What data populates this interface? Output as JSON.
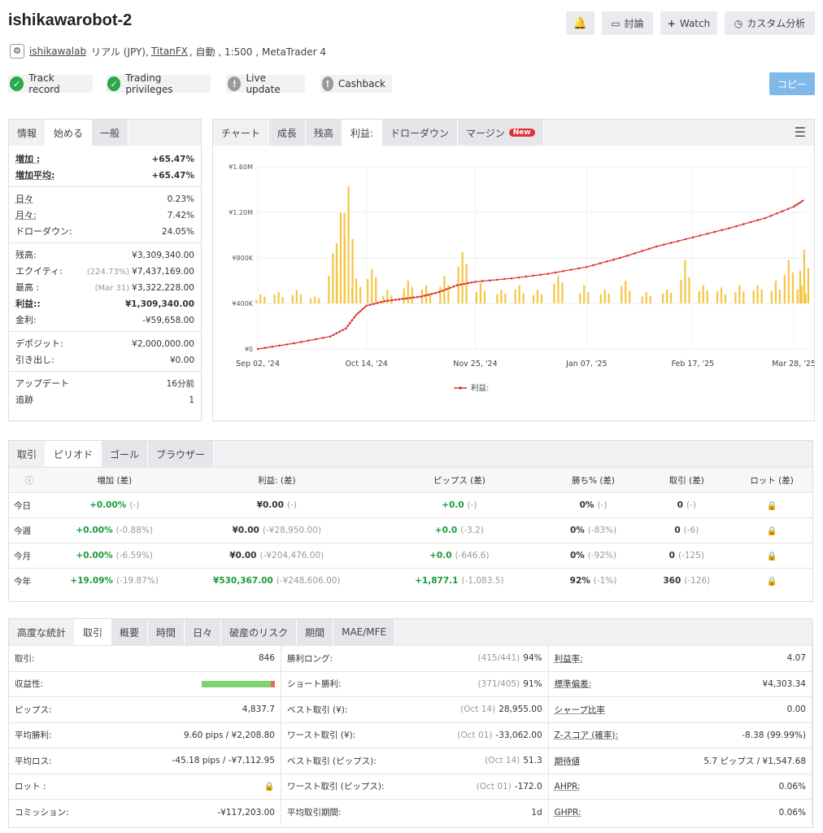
{
  "header": {
    "title": "ishikawarobot-2",
    "discuss": "討論",
    "watch": "Watch",
    "custom": "カスタム分析",
    "user": "ishikawalab",
    "account_type": "リアル (JPY),",
    "broker": "TitanFX",
    "details": ", 自動 , 1:500 , MetaTrader 4"
  },
  "badges": [
    {
      "label": "Track record",
      "ok": true
    },
    {
      "label": "Trading privileges",
      "ok": true
    },
    {
      "label": "Live update",
      "ok": false
    },
    {
      "label": "Cashback",
      "ok": false
    }
  ],
  "copy_button": "コピー",
  "info": {
    "tabs": [
      "情報",
      "始める",
      "一般"
    ],
    "rows": [
      {
        "k": "増加 :",
        "v": "+65.47%",
        "g": true,
        "ul": true
      },
      {
        "k": "増加平均:",
        "v": "+65.47%",
        "g": true,
        "ul": true
      },
      {
        "sep": true
      },
      {
        "k": "日々",
        "v": "0.23%",
        "ul": true
      },
      {
        "k": "月々:",
        "v": "7.42%",
        "ul": true
      },
      {
        "k": "ドローダウン:",
        "v": "24.05%"
      },
      {
        "sep": true
      },
      {
        "k": "残高:",
        "v": "¥3,309,340.00"
      },
      {
        "k": "エクイティ:",
        "pre": "(224.73%)",
        "v": "¥7,437,169.00"
      },
      {
        "k": "最高 :",
        "pre": "(Mar 31)",
        "v": "¥3,322,228.00"
      },
      {
        "k": "利益::",
        "v": "¥1,309,340.00",
        "g": true
      },
      {
        "k": "金利:",
        "v": "-¥59,658.00"
      },
      {
        "sep": true
      },
      {
        "k": "デポジット:",
        "v": "¥2,000,000.00"
      },
      {
        "k": "引き出し:",
        "v": "¥0.00"
      },
      {
        "sep": true
      },
      {
        "k": "アップデート",
        "v": "16分前"
      },
      {
        "k": "追跡",
        "v": "1"
      }
    ]
  },
  "chart_tabs": [
    {
      "label": "チャート"
    },
    {
      "label": "成長"
    },
    {
      "label": "残高"
    },
    {
      "label": "利益:"
    },
    {
      "label": "ドローダウン"
    },
    {
      "label": "マージン"
    }
  ],
  "new_badge": "New",
  "chart_data": {
    "type": "line",
    "x_ticks": [
      "Sep 02, '24",
      "Oct 14, '24",
      "Nov 25, '24",
      "Jan 07, '25",
      "Feb 17, '25",
      "Mar 28, '25"
    ],
    "y_ticks": [
      "¥0",
      "¥400K",
      "¥800K",
      "¥1.20M",
      "¥1.60M"
    ],
    "ylim": [
      0,
      1600000
    ],
    "series": [
      {
        "name": "利益:",
        "color": "#e03030",
        "x": [
          "2024-09-02",
          "2024-09-16",
          "2024-09-30",
          "2024-10-06",
          "2024-10-10",
          "2024-10-14",
          "2024-10-21",
          "2024-10-28",
          "2024-11-04",
          "2024-11-11",
          "2024-11-18",
          "2024-11-25",
          "2024-12-09",
          "2024-12-23",
          "2025-01-07",
          "2025-01-20",
          "2025-02-03",
          "2025-02-17",
          "2025-03-03",
          "2025-03-17",
          "2025-03-28",
          "2025-04-01"
        ],
        "values": [
          0,
          50000,
          110000,
          180000,
          300000,
          380000,
          420000,
          440000,
          460000,
          500000,
          560000,
          590000,
          620000,
          660000,
          720000,
          800000,
          900000,
          980000,
          1060000,
          1150000,
          1250000,
          1309340
        ]
      }
    ],
    "bars": {
      "color": "#f5c542",
      "baseline": 400000,
      "x": [
        "2024-09-03",
        "2024-09-10",
        "2024-09-17",
        "2024-09-24",
        "2024-10-01",
        "2024-10-04",
        "2024-10-07",
        "2024-10-10",
        "2024-10-16",
        "2024-10-22",
        "2024-10-30",
        "2024-11-06",
        "2024-11-13",
        "2024-11-20",
        "2024-11-27",
        "2024-12-05",
        "2024-12-12",
        "2024-12-19",
        "2024-12-27",
        "2025-01-06",
        "2025-01-14",
        "2025-01-22",
        "2025-01-30",
        "2025-02-07",
        "2025-02-14",
        "2025-02-21",
        "2025-02-28",
        "2025-03-07",
        "2025-03-14",
        "2025-03-21",
        "2025-03-26",
        "2025-03-31",
        "2025-04-01"
      ],
      "values": [
        480000,
        500000,
        520000,
        460000,
        840000,
        1200000,
        1430000,
        620000,
        700000,
        520000,
        600000,
        560000,
        640000,
        850000,
        580000,
        520000,
        560000,
        520000,
        640000,
        560000,
        520000,
        600000,
        500000,
        520000,
        780000,
        560000,
        540000,
        560000,
        560000,
        600000,
        780000,
        560000,
        870000
      ]
    },
    "legend": "利益:",
    "legend_position": "bottom"
  },
  "period": {
    "tabs": [
      "取引",
      "ピリオド",
      "ゴール",
      "ブラウザー"
    ],
    "headers": [
      "増加 (差)",
      "利益: (差)",
      "ピップス (差)",
      "勝ち% (差)",
      "取引 (差)",
      "ロット (差)"
    ],
    "rows": [
      {
        "label": "今日",
        "gain": "+0.00%",
        "gain_d": "(-)",
        "profit": "¥0.00",
        "profit_d": "(-)",
        "pips": "+0.0",
        "pips_d": "(-)",
        "win": "0%",
        "win_d": "(-)",
        "trades": "0",
        "trades_d": "(-)"
      },
      {
        "label": "今週",
        "gain": "+0.00%",
        "gain_d": "(-0.88%)",
        "profit": "¥0.00",
        "profit_d": "(-¥28,950.00)",
        "pips": "+0.0",
        "pips_d": "(-3.2)",
        "win": "0%",
        "win_d": "(-83%)",
        "trades": "0",
        "trades_d": "(-6)"
      },
      {
        "label": "今月",
        "gain": "+0.00%",
        "gain_d": "(-6.59%)",
        "profit": "¥0.00",
        "profit_d": "(-¥204,476.00)",
        "pips": "+0.0",
        "pips_d": "(-646.6)",
        "win": "0%",
        "win_d": "(-92%)",
        "trades": "0",
        "trades_d": "(-125)"
      },
      {
        "label": "今年",
        "gain": "+19.09%",
        "gain_d": "(-19.87%)",
        "profit": "¥530,367.00",
        "profit_d": "(-¥248,606.00)",
        "pips": "+1,877.1",
        "pips_d": "(-1,083.5)",
        "win": "92%",
        "win_d": "(-1%)",
        "trades": "360",
        "trades_d": "(-126)",
        "green_profit": true
      }
    ]
  },
  "stats": {
    "tabs": [
      "高度な統計",
      "取引",
      "概要",
      "時間",
      "日々",
      "破産のリスク",
      "期間",
      "MAE/MFE"
    ],
    "profitability_win_fraction": 0.94,
    "rows": [
      [
        {
          "k": "取引:",
          "v": "846"
        },
        {
          "k": "勝利ロング:",
          "pre": "(415/441)",
          "v": "94%"
        },
        {
          "k": "利益率:",
          "v": "4.07",
          "ul": true
        }
      ],
      [
        {
          "k": "収益性:",
          "bar": true
        },
        {
          "k": "ショート勝利:",
          "pre": "(371/405)",
          "v": "91%"
        },
        {
          "k": "標準偏差:",
          "v": "¥4,303.34",
          "ul": true
        }
      ],
      [
        {
          "k": "ピップス:",
          "v": "4,837.7"
        },
        {
          "k": "ベスト取引 (¥):",
          "pre": "(Oct 14)",
          "v": "28,955.00"
        },
        {
          "k": "シャープ比率",
          "v": "0.00",
          "ul": true
        }
      ],
      [
        {
          "k": "平均勝利:",
          "v": "9.60 pips / ¥2,208.80"
        },
        {
          "k": "ワースト取引 (¥):",
          "pre": "(Oct 01)",
          "v": "-33,062.00"
        },
        {
          "k": "Z-スコア (確率):",
          "v": "-8.38 (99.99%)",
          "ul": true
        }
      ],
      [
        {
          "k": "平均ロス:",
          "v": "-45.18 pips / -¥7,112.95"
        },
        {
          "k": "ベスト取引 (ピップス):",
          "pre": "(Oct 14)",
          "v": "51.3"
        },
        {
          "k": "期待値",
          "v": "5.7 ピップス / ¥1,547.68",
          "ul": true
        }
      ],
      [
        {
          "k": "ロット :",
          "lock": true
        },
        {
          "k": "ワースト取引 (ピップス):",
          "pre": "(Oct 01)",
          "v": "-172.0"
        },
        {
          "k": "AHPR:",
          "v": "0.06%",
          "ul": true
        }
      ],
      [
        {
          "k": "コミッション:",
          "v": "-¥117,203.00"
        },
        {
          "k": "平均取引期間:",
          "v": "1d"
        },
        {
          "k": "GHPR:",
          "v": "0.06%",
          "ul": true
        }
      ]
    ]
  }
}
